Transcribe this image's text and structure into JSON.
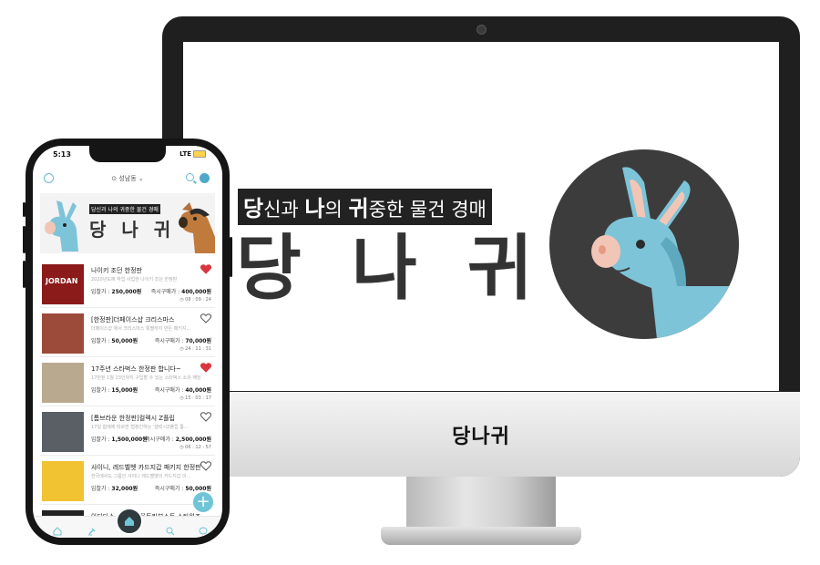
{
  "desktop": {
    "tagline_parts": [
      {
        "big": "당",
        "rest": "신과 "
      },
      {
        "big": "나",
        "rest": "의 "
      },
      {
        "big": "귀",
        "rest": "중한 물건 경매"
      }
    ],
    "brand": "당 나 귀",
    "chin_label": "당나귀"
  },
  "phone": {
    "status": {
      "time": "5:13",
      "network": "LTE"
    },
    "location": "성남동",
    "banner": {
      "tagline": "당신과 나의 귀중한 물건 경매",
      "brand": "당 나 귀"
    },
    "bid_label": "입찰가 :",
    "buy_label": "즉시구매가 :",
    "items": [
      {
        "title": "나이키 조던 한정판",
        "desc": "2020년도에 작업 사업한 나이키 조던 한정판",
        "bid": "250,000원",
        "buy": "400,000원",
        "timer": "08 : 09 : 24",
        "liked": true,
        "thumb_color": "#8b1a1a",
        "thumb_text": "JORDAN"
      },
      {
        "title": "[한정판]더페이스샵 크리스마스",
        "desc": "더페이스샵 에서 크리스마스 특별하지 만든 패키지...",
        "bid": "50,000원",
        "buy": "70,000원",
        "timer": "24 : 11 : 31",
        "liked": false,
        "thumb_color": "#9c4a3a",
        "thumb_text": ""
      },
      {
        "title": "17주년 스타벅스 한정판 합니다~",
        "desc": "17만된 1월 23인까지 구입할 수 있는 스타벅스 소유 해당된 정은",
        "bid": "15,000원",
        "buy": "40,000원",
        "timer": "15 : 03 : 17",
        "liked": true,
        "thumb_color": "#b9a98e",
        "thumb_text": ""
      },
      {
        "title": "[톰브라운 한정판]컬렉시 Z플립",
        "desc": "17일 합에에 따르면 법정인하는 '갤럭시Z플립 톰...",
        "bid": "1,500,000원",
        "buy": "2,500,000원",
        "timer": "06 : 12 : 57",
        "liked": false,
        "thumb_color": "#5a5f66",
        "thumb_text": ""
      },
      {
        "title": "샤이니, 레드벨벳 카드지갑 패키지 한정판",
        "desc": "한국에서도 그룹인 샤이니 레드벨벳의 카드지갑 이...",
        "bid": "32,000원",
        "buy": "50,000원",
        "timer": "",
        "liked": false,
        "thumb_color": "#f1c232",
        "thumb_text": ""
      }
    ],
    "last_item_title": "아디다스, 한정판 '울트라부스트 스타워즈'",
    "fab_label": "+",
    "tabs": [
      "home",
      "auction",
      "center",
      "search",
      "chat"
    ],
    "accent": "#6fc4d6"
  }
}
